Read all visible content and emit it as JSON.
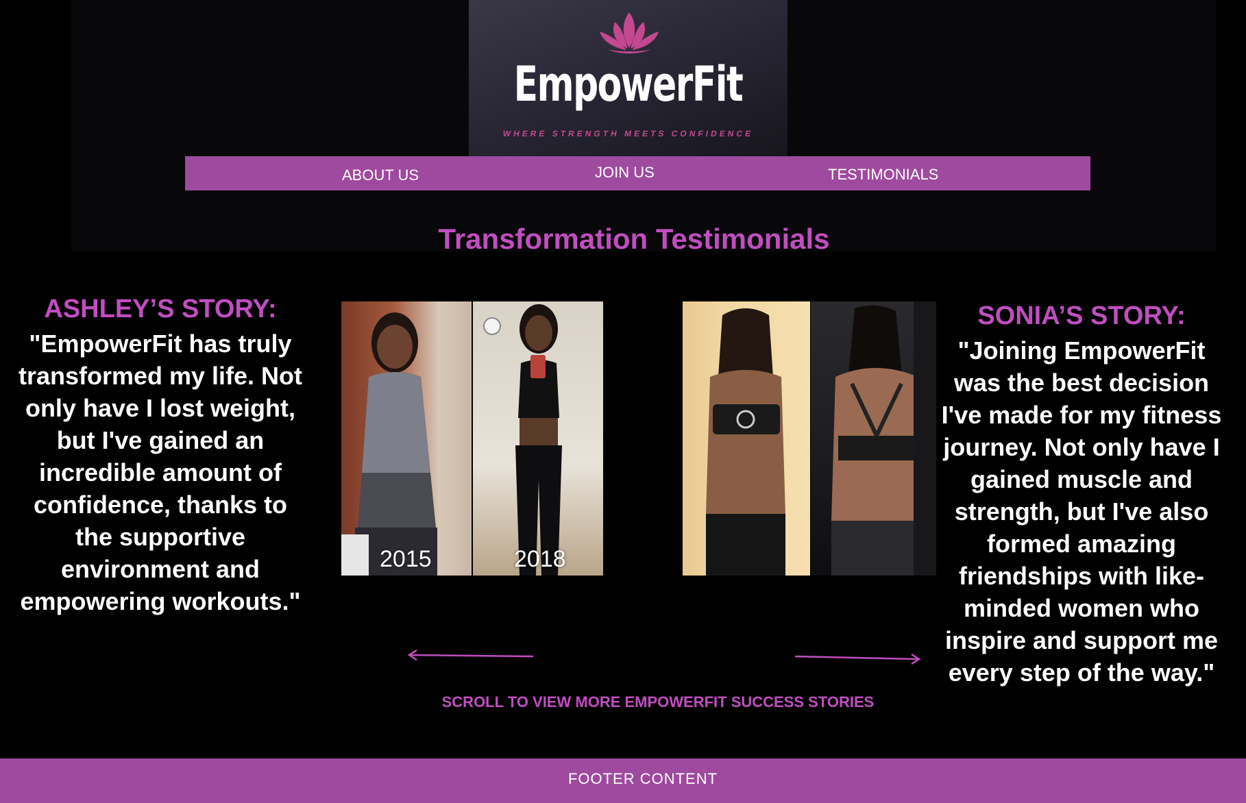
{
  "brand": {
    "name": "EmpowerFit",
    "tagline": "WHERE STRENGTH MEETS CONFIDENCE",
    "logo_icon": "lotus-icon"
  },
  "nav": {
    "items": [
      {
        "label": "ABOUT US"
      },
      {
        "label": "JOIN US"
      },
      {
        "label": "TESTIMONIALS"
      }
    ]
  },
  "page": {
    "title": "Transformation Testimonials"
  },
  "stories": [
    {
      "heading": "ASHLEY’S STORY:",
      "quote": "\"EmpowerFit has truly transformed my life. Not only have I lost weight, but I've gained an incredible amount of confidence, thanks to the supportive environment and empowering workouts.\"",
      "before_year": "2015",
      "after_year": "2018"
    },
    {
      "heading": "SONIA’S STORY:",
      "quote": "\"Joining EmpowerFit was the best decision I've made for my fitness journey. Not only have I gained muscle and strength, but I've also formed amazing friendships with like-minded women who inspire and support me every step of the way.\""
    }
  ],
  "carousel": {
    "prev_icon": "arrow-left-icon",
    "next_icon": "arrow-right-icon",
    "scroll_label": "SCROLL TO VIEW MORE EMPOWERFIT SUCCESS STORIES"
  },
  "footer": {
    "text": "FOOTER CONTENT"
  },
  "colors": {
    "accent": "#9e4a9e",
    "heading_purple": "#c04ec0",
    "background": "#000000",
    "tagline_pink": "#c2488f"
  }
}
